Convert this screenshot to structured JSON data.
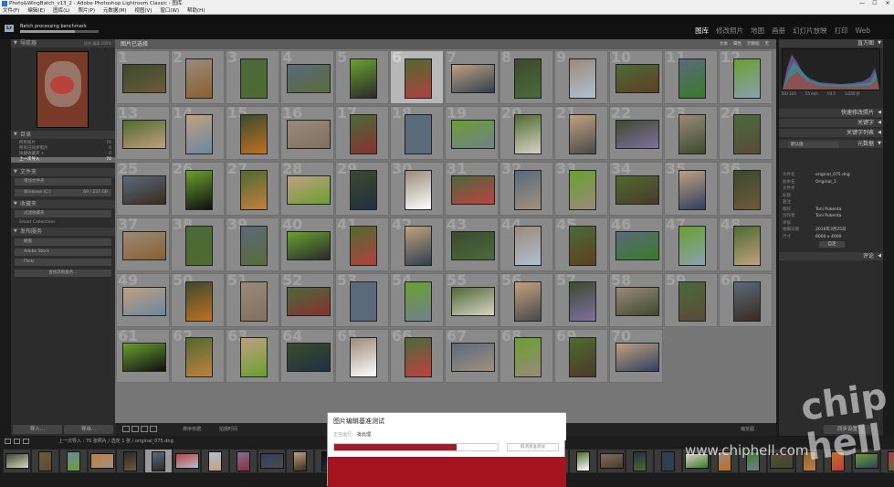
{
  "window": {
    "title": "Photo&WingBatch_v13_2 - Adobe Photoshop Lightroom Classic - 图库",
    "minimize": "—",
    "maximize": "☐",
    "close": "✕"
  },
  "menu": [
    "文件(F)",
    "编辑(E)",
    "图库(L)",
    "照片(P)",
    "元数据(M)",
    "视图(V)",
    "窗口(W)",
    "帮助(H)"
  ],
  "identity": {
    "logo": "Lr",
    "task_label": "Batch processing benchmark",
    "task_progress": 0.7,
    "modules": [
      "图库",
      "修改照片",
      "地图",
      "画册",
      "幻灯片放映",
      "打印",
      "Web"
    ],
    "active_module": "图库"
  },
  "left": {
    "navigator": {
      "title": "导航器",
      "options": [
        "适合",
        "填满",
        "100%"
      ]
    },
    "catalog": {
      "title": "目录",
      "rows": [
        {
          "label": "所有照片",
          "count": "70"
        },
        {
          "label": "所有已同步照片",
          "count": "0"
        },
        {
          "label": "快捷收藏夹 +",
          "count": "0"
        },
        {
          "label": "上一次导入",
          "count": "70"
        }
      ],
      "selected_index": 3
    },
    "folders": {
      "title": "文件夹",
      "add_label": "增加文件夹",
      "volume": "Windows (C:)",
      "volume_size": "69 / 237 GB"
    },
    "collections": {
      "title": "收藏夹",
      "filter": "过滤收藏夹",
      "items": [
        "Smart Collections"
      ]
    },
    "publish": {
      "title": "发布服务",
      "items": [
        "硬盘",
        "Adobe Stock",
        "Flickr"
      ],
      "more": "查找其他服务..."
    },
    "import_button": "导入...",
    "export_button": "导出..."
  },
  "grid": {
    "header": "图片已选择",
    "filter_options": [
      "文本",
      "属性",
      "元数据",
      "无"
    ],
    "selected": 6
  },
  "grid_toolbar": {
    "sort_label": "排序依据:",
    "sort_value": "拍摄时间",
    "thumbs_label": "缩览图"
  },
  "right": {
    "histogram_title": "直方图",
    "exif": [
      "ISO 320",
      "55 mm",
      "f/4.5",
      "1/250 秒"
    ],
    "quick_develop": "快速修改照片",
    "keywording": "关键字",
    "keyword_list": "关键字列表",
    "metadata_title": "元数据",
    "preset_label": "默认值",
    "metadata_rows": [
      {
        "k": "文件名",
        "v": "original_075.dng"
      },
      {
        "k": "副本名",
        "v": "Original_1"
      },
      {
        "k": "文件夹",
        "v": ""
      },
      {
        "k": "标题",
        "v": ""
      },
      {
        "k": "题注",
        "v": ""
      },
      {
        "k": "版权",
        "v": "Toni Pukenta"
      },
      {
        "k": "创作者",
        "v": "Toni Pukenta"
      },
      {
        "k": "评级",
        "v": ""
      },
      {
        "k": "拍摄日期",
        "v": "2016年3月25日"
      },
      {
        "k": "尺寸",
        "v": "6000 x 4000"
      }
    ],
    "customize": "自定",
    "comments": "评论",
    "sync_meta": "同步元数据",
    "sync_settings": "同步设置"
  },
  "filmstrip": {
    "path": "上一次导入 : 70 张照片 / 选定 1 张 / original_075.dng"
  },
  "dialog": {
    "title": "图片编辑基准测试",
    "status_label": "正在运行:",
    "status_value": "批处理",
    "progress": 0.75,
    "button": "取消基准测试"
  },
  "watermark": {
    "url": "www.chiphell.com",
    "logo": "chip hell"
  }
}
